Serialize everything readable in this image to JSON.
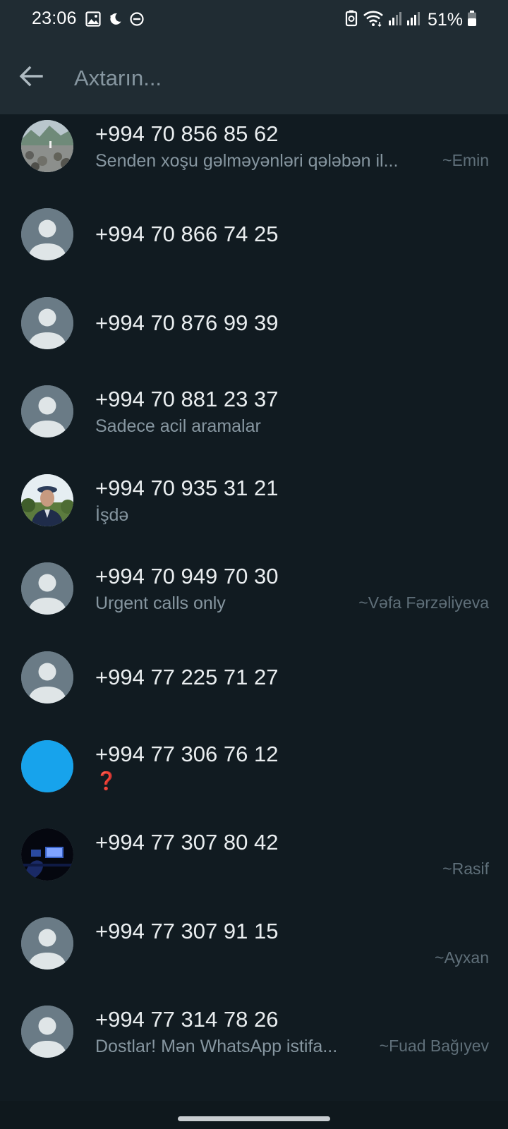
{
  "status_bar": {
    "time": "23:06",
    "battery": "51%",
    "icons": [
      "gallery-icon",
      "moon-icon",
      "dnd-icon",
      "battery-saver-icon",
      "wifi-icon",
      "signal-icon",
      "signal-icon",
      "battery-icon"
    ]
  },
  "search": {
    "placeholder": "Axtarın...",
    "value": ""
  },
  "colors": {
    "header_bg": "#202c33",
    "list_bg": "#111b21",
    "name_text": "#e9edef",
    "secondary_text": "#8696a0",
    "default_avatar_bg": "#6a7b86",
    "blue_avatar": "#17a3ec"
  },
  "contacts": [
    {
      "name": "+994 70 856 85 62",
      "about": "Senden xoşu gəlməyənləri qələbən il...",
      "pushname": "~Emin",
      "avatar": "photo-landscape"
    },
    {
      "name": "+994 70 866 74 25",
      "about": "",
      "pushname": "",
      "avatar": "default"
    },
    {
      "name": "+994 70 876 99 39",
      "about": "",
      "pushname": "",
      "avatar": "default"
    },
    {
      "name": "+994 70 881 23 37",
      "about": "Sadece acil aramalar",
      "pushname": "",
      "avatar": "default"
    },
    {
      "name": "+994 70 935 31 21",
      "about": "İşdə",
      "pushname": "",
      "avatar": "photo-person"
    },
    {
      "name": "+994 70 949 70 30",
      "about": "Urgent calls only",
      "pushname": "~Vəfa Fərzəliyeva",
      "avatar": "default"
    },
    {
      "name": "+994 77 225 71 27",
      "about": "",
      "pushname": "",
      "avatar": "default"
    },
    {
      "name": "+994 77 306 76 12",
      "about": "❓",
      "pushname": "",
      "avatar": "solid-blue"
    },
    {
      "name": "+994 77 307 80 42",
      "about": "",
      "pushname": "~Rasif",
      "avatar": "photo-dark"
    },
    {
      "name": "+994 77 307 91 15",
      "about": "",
      "pushname": "~Ayxan",
      "avatar": "default"
    },
    {
      "name": "+994 77 314 78 26",
      "about": "Dostlar! Mən WhatsApp istifa...",
      "pushname": "~Fuad Bağıyev",
      "avatar": "default"
    }
  ]
}
